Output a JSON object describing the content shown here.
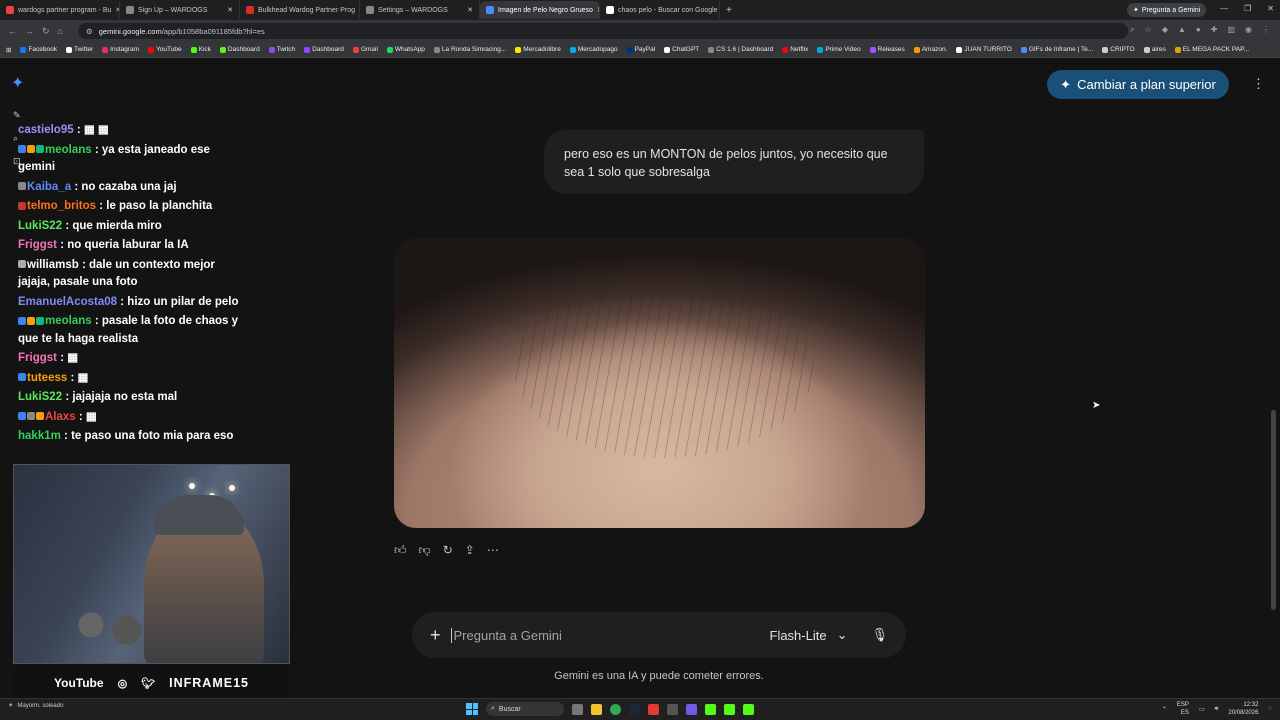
{
  "browser": {
    "tabs": [
      {
        "title": "wardogs partner program - Bu",
        "color": "#e8453c"
      },
      {
        "title": "Sign Up – WARDOGS",
        "color": "#888888"
      },
      {
        "title": "Bulkhead Wardog Partner Prog",
        "color": "#d93025"
      },
      {
        "title": "Settings – WARDOGS",
        "color": "#888888"
      },
      {
        "title": "Imagen de Pelo Negro Grueso",
        "color": "#4c8df6",
        "active": true
      },
      {
        "title": "chaos pelo - Buscar con Google",
        "color": "#ffffff"
      }
    ],
    "gemini_pill": "Pregunta a Gemini",
    "url_host": "gemini.google.com",
    "url_path": "/app/b1058ba091185fdb?hl=es",
    "bookmarks": [
      {
        "label": "Facebook",
        "color": "#1877f2"
      },
      {
        "label": "Twitter",
        "color": "#ffffff"
      },
      {
        "label": "Instagram",
        "color": "#e1306c"
      },
      {
        "label": "YouTube",
        "color": "#ff0000"
      },
      {
        "label": "Kick",
        "color": "#53fc18"
      },
      {
        "label": "Dashboard",
        "color": "#53fc18"
      },
      {
        "label": "Twitch",
        "color": "#9146ff"
      },
      {
        "label": "Dashboard",
        "color": "#9146ff"
      },
      {
        "label": "Gmail",
        "color": "#ea4335"
      },
      {
        "label": "WhatsApp",
        "color": "#25d366"
      },
      {
        "label": "La Ronda Simracing...",
        "color": "#888888"
      },
      {
        "label": "Mercadolibre",
        "color": "#ffe600"
      },
      {
        "label": "Mercadopago",
        "color": "#00b1ea"
      },
      {
        "label": "PayPal",
        "color": "#003087"
      },
      {
        "label": "ChatGPT",
        "color": "#ffffff"
      },
      {
        "label": "CS 1.6 | Dashboard",
        "color": "#888888"
      },
      {
        "label": "Netflix",
        "color": "#e50914"
      },
      {
        "label": "Prime Video",
        "color": "#00a8e1"
      },
      {
        "label": "Releases",
        "color": "#a64dff"
      },
      {
        "label": "Amazon.",
        "color": "#ff9900"
      },
      {
        "label": "JUAN TURRITO",
        "color": "#ffffff"
      },
      {
        "label": "GIFs de Inframe | Te...",
        "color": "#4c8df6"
      },
      {
        "label": "CRIPTO",
        "color": "#cccccc"
      },
      {
        "label": "aires",
        "color": "#cccccc"
      },
      {
        "label": "EL MEGA PACK PAP...",
        "color": "#e1a100"
      }
    ]
  },
  "chat": [
    {
      "user": "castielo95",
      "user_color": "#a78bfa",
      "badges": [],
      "text": ": ▦ ▦"
    },
    {
      "user": "meolans",
      "user_color": "#34d058",
      "badges": [
        "#3b82f6",
        "#f59e0b",
        "#10b981"
      ],
      "text": ": ya esta janeado ese gemini"
    },
    {
      "user": "Kaiba_a",
      "user_color": "#5b8def",
      "badges": [
        "#888888"
      ],
      "text": ": no cazaba una jaj"
    },
    {
      "user": "telmo_britos",
      "user_color": "#f97316",
      "badges": [
        "#c0392b"
      ],
      "text": ": le paso la planchita"
    },
    {
      "user": "LukiS22",
      "user_color": "#5ee65e",
      "badges": [],
      "text": ": que mierda miro"
    },
    {
      "user": "Friggst",
      "user_color": "#f472b6",
      "badges": [],
      "text": ": no queria laburar la IA"
    },
    {
      "user": "williamsb",
      "user_color": "#ffffff",
      "badges": [
        "#aaaaaa"
      ],
      "text": ": dale un contexto mejor jajaja, pasale una foto"
    },
    {
      "user": "EmanuelAcosta08",
      "user_color": "#818cf8",
      "badges": [],
      "text": ": hizo un pilar de pelo"
    },
    {
      "user": "meolans",
      "user_color": "#34d058",
      "badges": [
        "#3b82f6",
        "#f59e0b",
        "#10b981"
      ],
      "text": ": pasale la foto de chaos y que te la haga realista"
    },
    {
      "user": "Friggst",
      "user_color": "#f472b6",
      "badges": [],
      "text": ": ▦"
    },
    {
      "user": "tuteess",
      "user_color": "#f59e0b",
      "badges": [
        "#3b82f6"
      ],
      "text": ": ▦"
    },
    {
      "user": "LukiS22",
      "user_color": "#5ee65e",
      "badges": [],
      "text": ": jajajaja no esta mal"
    },
    {
      "user": "Alaxs",
      "user_color": "#ef4444",
      "badges": [
        "#3b82f6",
        "#888888",
        "#f59e0b"
      ],
      "text": ": ▦"
    },
    {
      "user": "hakk1m",
      "user_color": "#34d058",
      "badges": [],
      "text": ": te paso una foto mia para eso"
    }
  ],
  "stream_bar": {
    "youtube": "YouTube",
    "handle": "INFRAME15"
  },
  "gemini": {
    "upgrade_label": "Cambiar a plan superior",
    "user_message": "pero eso es un MONTON de pelos juntos, yo necesito que sea 1 solo que sobresalga",
    "composer_placeholder": "Pregunta a Gemini",
    "model_label": "Flash-Lite",
    "disclaimer": "Gemini es una IA y puede cometer errores."
  },
  "taskbar": {
    "weather": "Mayorm. soleado",
    "search_label": "Buscar",
    "lang_top": "ESP",
    "lang_bottom": "ES",
    "time": "12:32",
    "date": "20/08/2026"
  }
}
